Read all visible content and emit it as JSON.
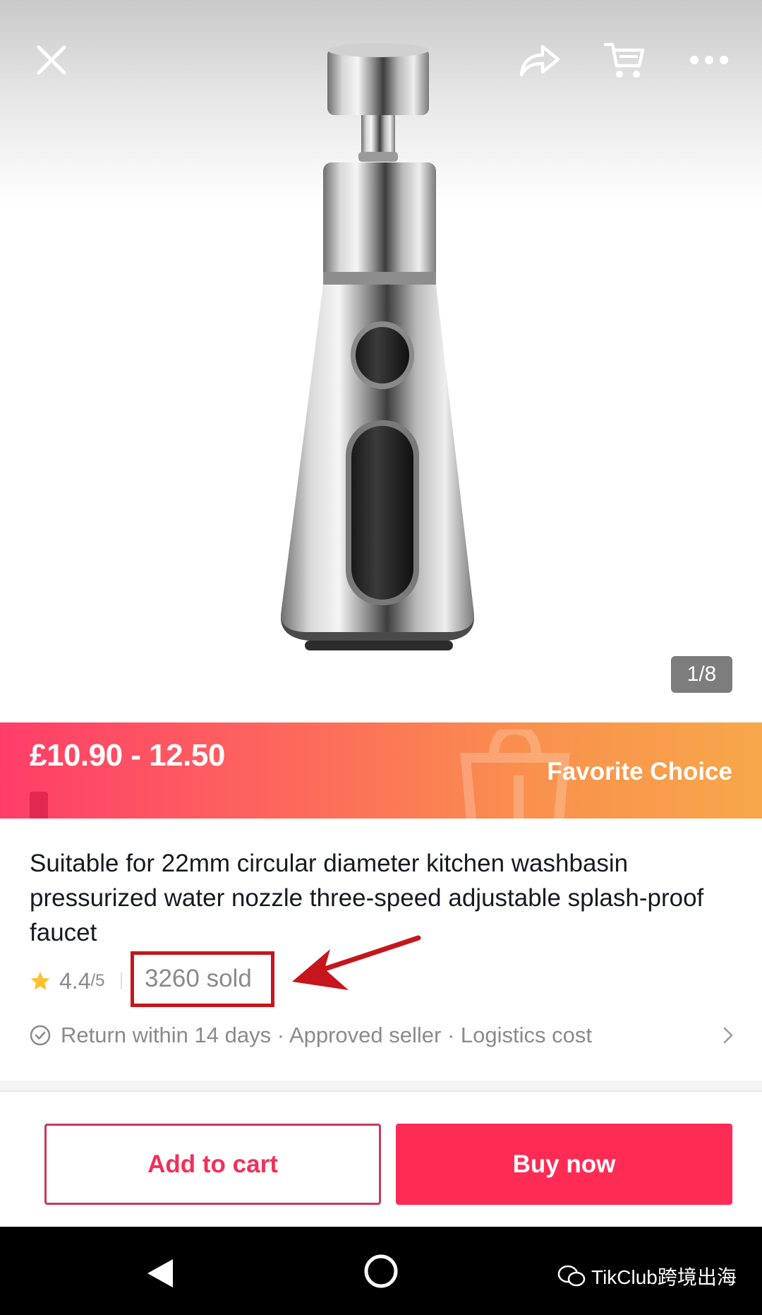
{
  "header": {
    "close_icon": "close-icon",
    "share_icon": "share-icon",
    "cart_icon": "cart-icon",
    "more_icon": "more-icon"
  },
  "gallery": {
    "page_counter": "1/8"
  },
  "price_banner": {
    "price": "£10.90 - 12.50",
    "badge": "Favorite Choice",
    "gradient_start": "#ff3d69",
    "gradient_end": "#f7a74a"
  },
  "product": {
    "title": "Suitable for 22mm circular diameter kitchen washbasin pressurized water nozzle three-speed adjustable splash-proof faucet",
    "rating": "4.4",
    "rating_out_of": "/5",
    "sold": "3260 sold",
    "policy": "Return within 14 days · Approved seller · Logistics cost"
  },
  "actions": {
    "add_to_cart": "Add to cart",
    "buy_now": "Buy now",
    "accent_color": "#fe2c55"
  },
  "navbar": {
    "watermark": "TikClub跨境出海"
  }
}
